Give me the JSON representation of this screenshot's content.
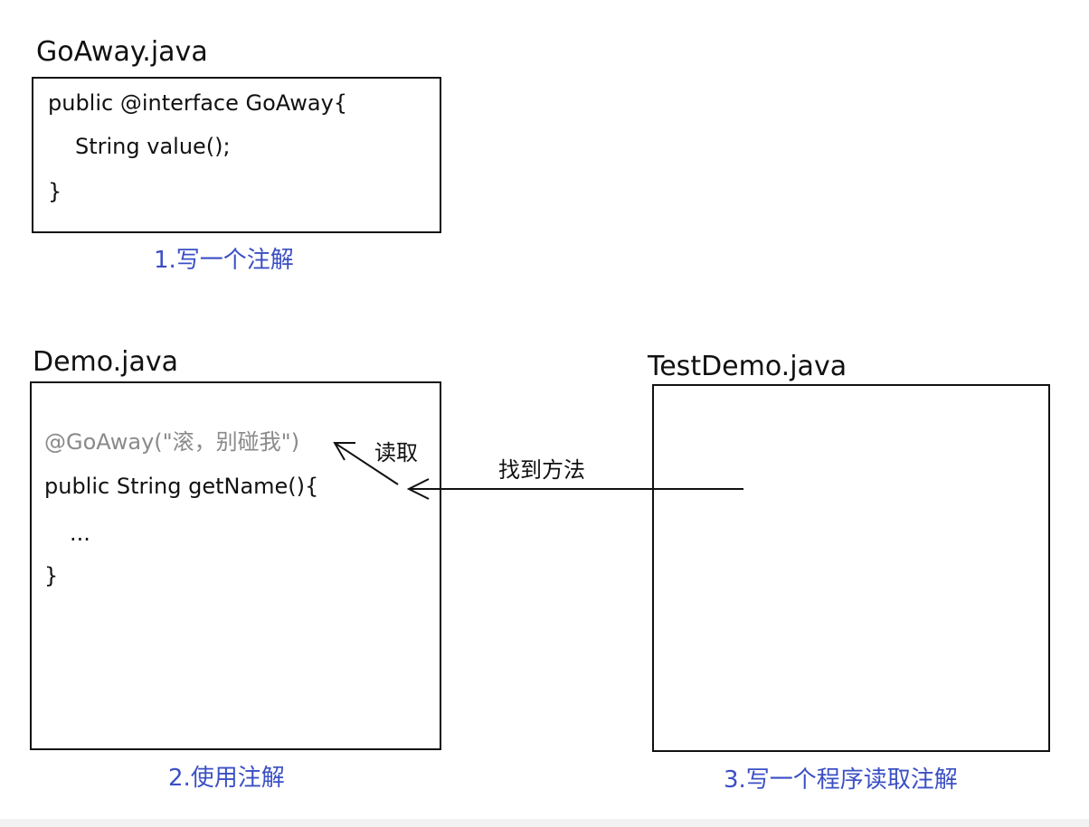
{
  "annotation_file": {
    "title": "GoAway.java",
    "lines": [
      "public @interface GoAway{",
      "String value();",
      "}"
    ],
    "caption": "1.写一个注解"
  },
  "demo_file": {
    "title": "Demo.java",
    "lines": [
      "@GoAway(\"滚，别碰我\")",
      "public String getName(){",
      "...",
      "}"
    ],
    "caption": "2.使用注解"
  },
  "test_file": {
    "title": "TestDemo.java",
    "caption": "3.写一个程序读取注解"
  },
  "arrows": {
    "read_label": "读取",
    "find_method_label": "找到方法"
  },
  "colors": {
    "caption": "#3b4fc4",
    "annotation_text": "#8a8a8a",
    "stroke": "#111111"
  }
}
